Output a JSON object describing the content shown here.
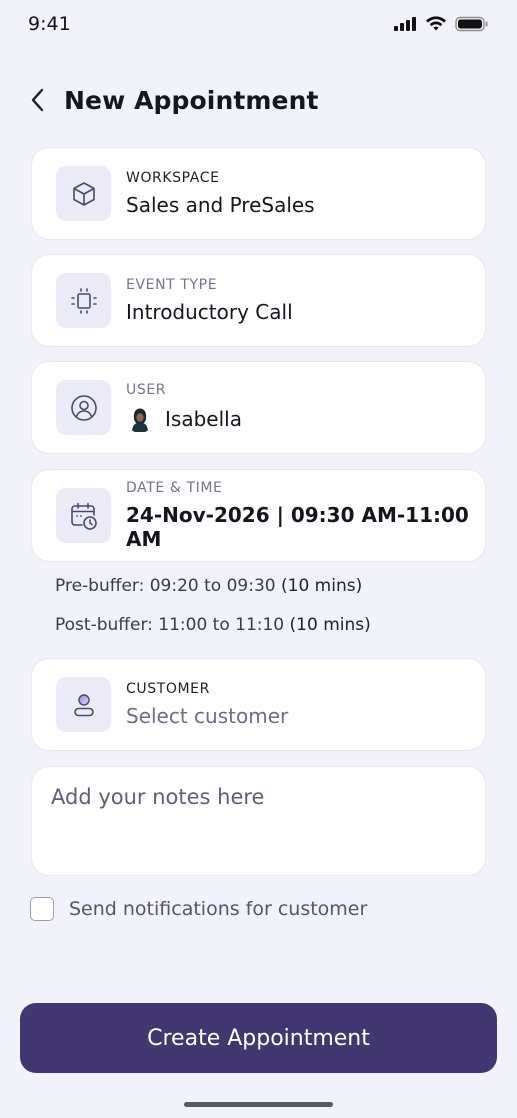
{
  "status_bar": {
    "time": "9:41"
  },
  "header": {
    "title": "New Appointment"
  },
  "workspace": {
    "label": "WORKSPACE",
    "value": "Sales and PreSales"
  },
  "event_type": {
    "label": "EVENT TYPE",
    "value": "Introductory Call"
  },
  "user": {
    "label": "USER",
    "value": "Isabella"
  },
  "date_time": {
    "label": "DATE & TIME",
    "value": "24-Nov-2026 | 09:30 AM-11:00 AM"
  },
  "pre_buffer": {
    "label": "Pre-buffer:",
    "range": "09:20 to 09:30",
    "duration": "(10 mins)"
  },
  "post_buffer": {
    "label": "Post-buffer:",
    "range": "11:00 to 11:10",
    "duration": "(10 mins)"
  },
  "customer": {
    "label": "CUSTOMER",
    "placeholder": "Select customer"
  },
  "notes": {
    "placeholder": "Add your notes here"
  },
  "notification": {
    "label": "Send notifications for customer",
    "checked": false
  },
  "actions": {
    "create_label": "Create Appointment"
  },
  "colors": {
    "background": "#f2f2fa",
    "primary_button": "#423771",
    "icon_tile": "#ebebf7",
    "icon_stroke": "#4a4a6a"
  }
}
